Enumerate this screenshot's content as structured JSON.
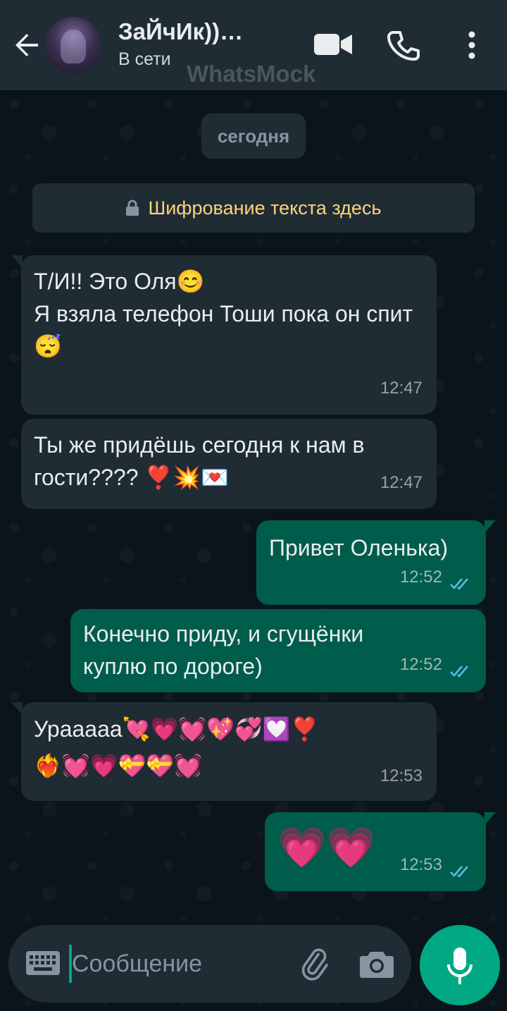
{
  "header": {
    "contact_name": "ЗаЙчИк))…",
    "status": "В сети",
    "watermark": "WhatsMock"
  },
  "date_chip": "сегодня",
  "encryption_notice": "Шифрование текста здесь",
  "messages": [
    {
      "direction": "in",
      "text": "Т/И!! Это Оля😊\nЯ взяла телефон Тоши пока он спит😴",
      "time": "12:47"
    },
    {
      "direction": "in",
      "text": "Ты же придёшь сегодня к нам в гости???? ❣️💥💌",
      "time": "12:47"
    },
    {
      "direction": "out",
      "text": "Привет Оленька)",
      "time": "12:52",
      "read": true
    },
    {
      "direction": "out",
      "text": "Конечно приду, и сгущёнки куплю по дороге)",
      "time": "12:52",
      "read": true
    },
    {
      "direction": "in",
      "text": "Урааааа💘💗💓💖💞💟❣️\n❤️‍🔥💓💗💝💝💓",
      "time": "12:53"
    },
    {
      "direction": "out",
      "text": "💗💗",
      "time": "12:53",
      "read": true
    }
  ],
  "composer": {
    "placeholder": "Сообщение"
  },
  "colors": {
    "header_bg": "#1f2c34",
    "chat_bg": "#0b141a",
    "incoming_bubble": "#1f2c34",
    "outgoing_bubble": "#005c4b",
    "accent": "#00a884",
    "read_ticks": "#53bdeb",
    "encryption_text": "#ffd279"
  },
  "icons": [
    "back-arrow-icon",
    "video-call-icon",
    "phone-icon",
    "more-vert-icon",
    "lock-icon",
    "keyboard-icon",
    "paperclip-icon",
    "camera-icon",
    "mic-icon",
    "double-check-icon"
  ]
}
